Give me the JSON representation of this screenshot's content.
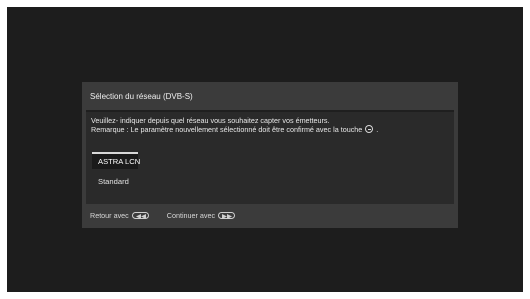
{
  "dialog": {
    "title": "Sélection du réseau (DVB-S)",
    "message_line1": "Veuillez- indiquer depuis quel réseau vous souhaitez capter vos émetteurs.",
    "message_line2_before": "Remarque : Le paramètre nouvellement sélectionné doit être confirmé avec la touche",
    "message_line2_after": ".",
    "confirm_icon": "ok-button-icon"
  },
  "options": [
    {
      "label": "ASTRA LCN",
      "selected": true
    },
    {
      "label": "Standard",
      "selected": false
    }
  ],
  "footer": {
    "back_label": "Retour avec",
    "back_icon": "rewind-button-icon",
    "continue_label": "Continuer avec",
    "continue_icon": "fast-forward-button-icon"
  },
  "colors": {
    "screen_background": "#1d1d1d",
    "dialog_background": "#3b3b3b",
    "panel_background": "#2a2a2a",
    "selected_background": "#1a1a1a",
    "text": "#e6e6e6"
  }
}
